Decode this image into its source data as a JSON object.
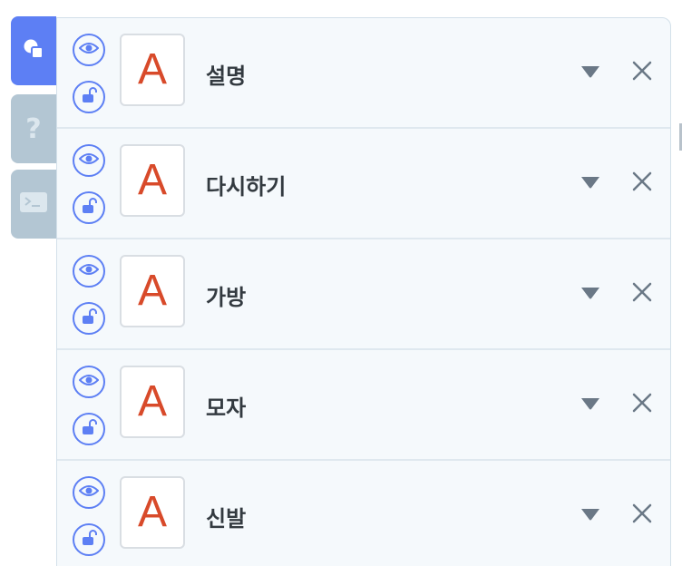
{
  "side_tabs": [
    {
      "id": "objects",
      "icon": "objects-icon",
      "active": true
    },
    {
      "id": "help",
      "icon": "question-icon",
      "glyph": "?",
      "active": false
    },
    {
      "id": "console",
      "icon": "console-icon",
      "active": false
    }
  ],
  "sprites": [
    {
      "name": "설명",
      "thumbnail_letter": "A"
    },
    {
      "name": "다시하기",
      "thumbnail_letter": "A"
    },
    {
      "name": "가방",
      "thumbnail_letter": "A"
    },
    {
      "name": "모자",
      "thumbnail_letter": "A"
    },
    {
      "name": "신발",
      "thumbnail_letter": "A"
    }
  ],
  "row_icons": {
    "visibility": "eye-icon",
    "lock": "unlock-icon",
    "menu": "caret-down-icon",
    "delete": "close-icon"
  },
  "colors": {
    "accent": "#5d7ff4",
    "tab_inactive": "#b3c6d3",
    "panel_bg": "#f5f9fc",
    "thumb_letter": "#d84a2a",
    "text": "#333a40",
    "icon_grey": "#6a7886"
  }
}
